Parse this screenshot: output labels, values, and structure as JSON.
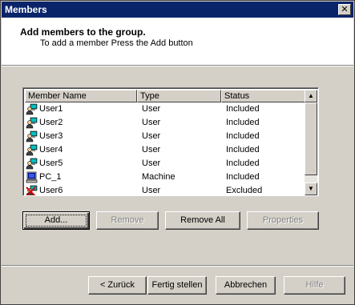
{
  "window": {
    "title": "Members",
    "close_glyph": "✕"
  },
  "header": {
    "heading": "Add members to the group.",
    "subheading": "To add a member Press the Add button"
  },
  "list": {
    "columns": [
      "Member Name",
      "Type",
      "Status"
    ],
    "rows": [
      {
        "name": "User1",
        "type": "User",
        "status": "Included",
        "icon": "user-icon"
      },
      {
        "name": "User2",
        "type": "User",
        "status": "Included",
        "icon": "user-icon"
      },
      {
        "name": "User3",
        "type": "User",
        "status": "Included",
        "icon": "user-icon"
      },
      {
        "name": "User4",
        "type": "User",
        "status": "Included",
        "icon": "user-icon"
      },
      {
        "name": "User5",
        "type": "User",
        "status": "Included",
        "icon": "user-icon"
      },
      {
        "name": "PC_1",
        "type": "Machine",
        "status": "Included",
        "icon": "computer-icon"
      },
      {
        "name": "User6",
        "type": "User",
        "status": "Excluded",
        "icon": "excluded-user-icon"
      }
    ]
  },
  "actions": {
    "add": "Add...",
    "remove": "Remove",
    "remove_all": "Remove All",
    "properties": "Properties"
  },
  "footer": {
    "back": "< Zurück",
    "finish": "Fertig stellen",
    "cancel": "Abbrechen",
    "help": "Hilfe"
  }
}
